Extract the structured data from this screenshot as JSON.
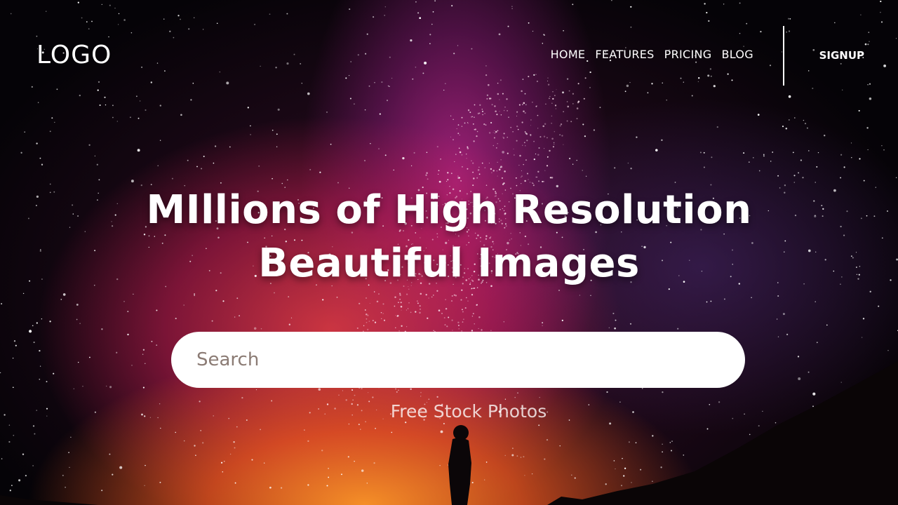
{
  "header": {
    "logo": "LOGO",
    "nav": [
      "HOME",
      "FEATURES",
      "PRICING",
      "BLOG"
    ],
    "signup": "SIGNUP"
  },
  "hero": {
    "headline_line1": "MIllions of High Resolution",
    "headline_line2": "Beautiful Images",
    "search_placeholder": "Search",
    "tagline": "Free Stock Photos"
  },
  "background": {
    "scene": "starry-night-sky",
    "colors": {
      "sky": "#050307",
      "nebula_pink": "#c8289a",
      "glow_red": "#e63c46",
      "glow_orange": "#ff9628"
    }
  }
}
